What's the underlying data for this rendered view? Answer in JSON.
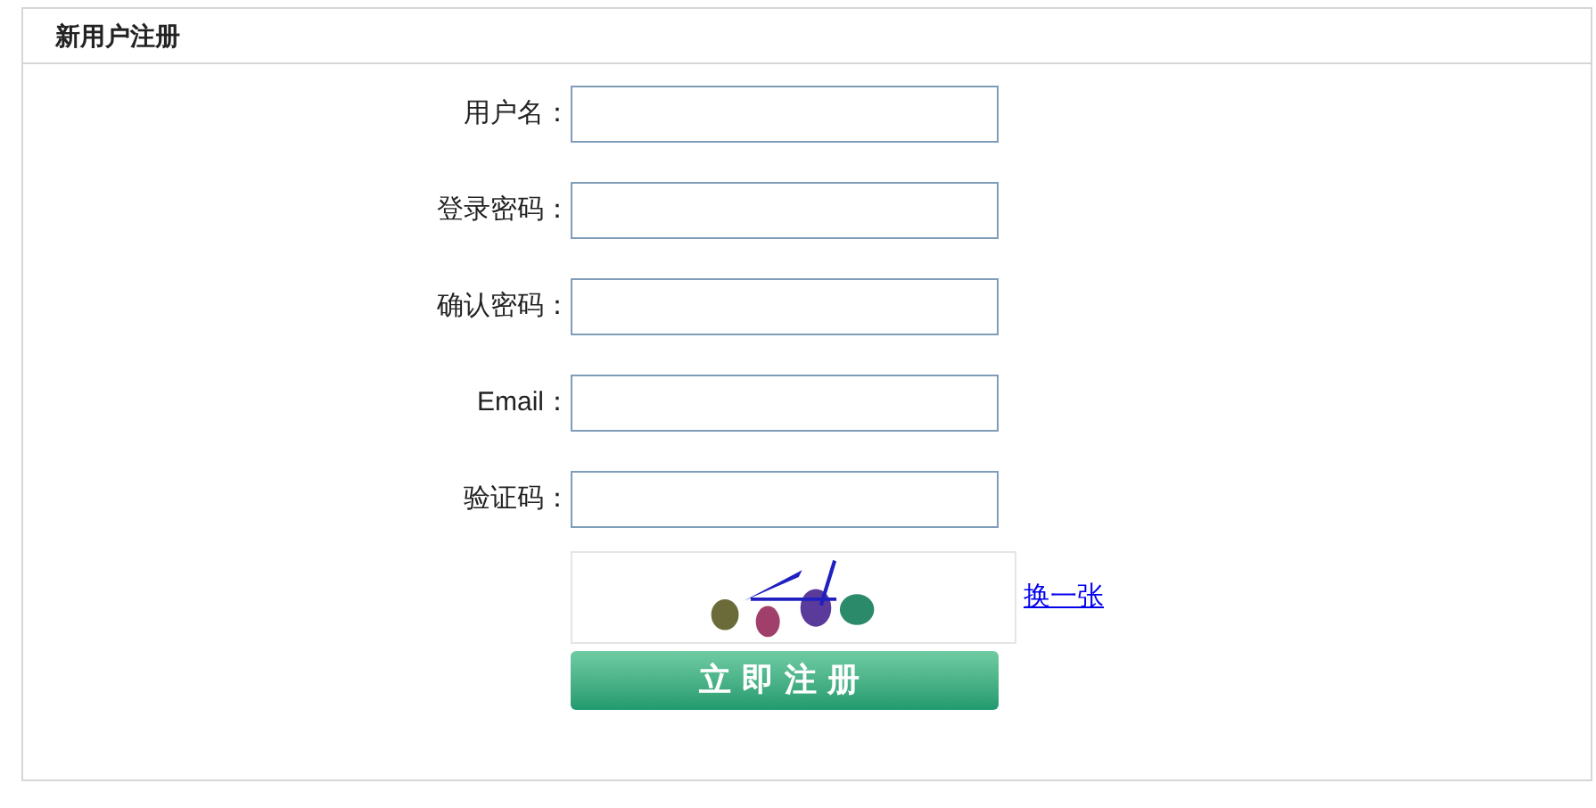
{
  "panel": {
    "title": "新用户注册"
  },
  "fields": [
    {
      "label": "用户名："
    },
    {
      "label": "登录密码："
    },
    {
      "label": "确认密码："
    },
    {
      "label": "Email："
    },
    {
      "label": "验证码："
    }
  ],
  "captcha": {
    "kind": "picture",
    "refresh_link": "换一张"
  },
  "submit_button": "立即注册"
}
